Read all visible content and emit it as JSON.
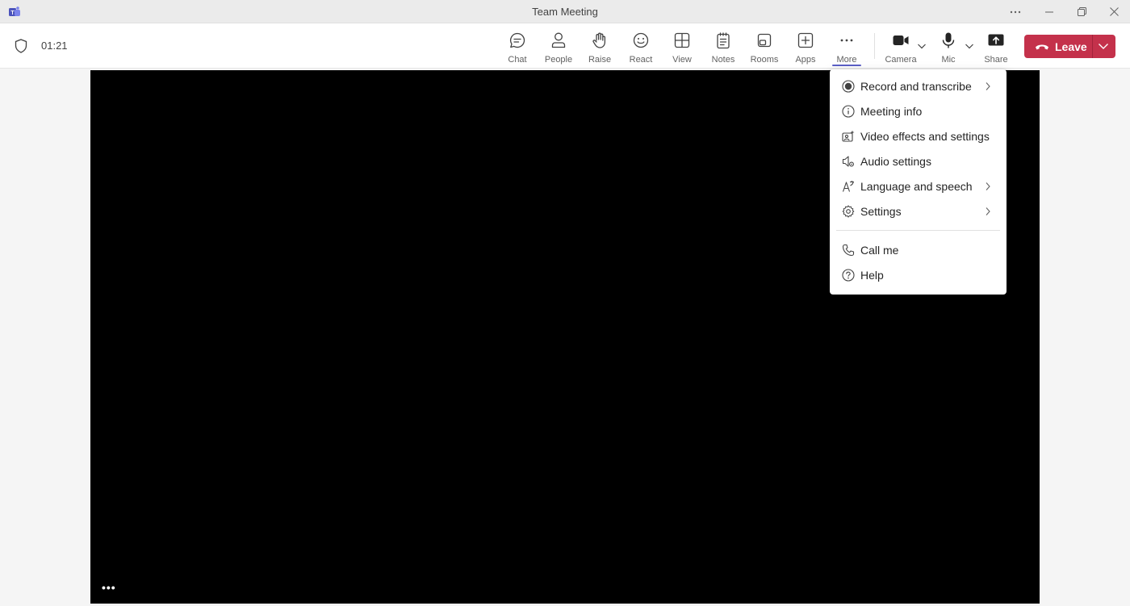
{
  "window": {
    "title": "Team Meeting"
  },
  "meeting": {
    "timer": "01:21"
  },
  "toolbar": {
    "chat": "Chat",
    "people": "People",
    "raise": "Raise",
    "react": "React",
    "view": "View",
    "notes": "Notes",
    "rooms": "Rooms",
    "apps": "Apps",
    "more": "More",
    "camera": "Camera",
    "mic": "Mic",
    "share": "Share",
    "leave": "Leave"
  },
  "more_menu": {
    "items": [
      {
        "label": "Record and transcribe",
        "icon": "record-icon",
        "submenu": true
      },
      {
        "label": "Meeting info",
        "icon": "info-icon",
        "submenu": false
      },
      {
        "label": "Video effects and settings",
        "icon": "video-effects-icon",
        "submenu": false
      },
      {
        "label": "Audio settings",
        "icon": "audio-settings-icon",
        "submenu": false
      },
      {
        "label": "Language and speech",
        "icon": "language-icon",
        "submenu": true
      },
      {
        "label": "Settings",
        "icon": "gear-icon",
        "submenu": true
      },
      {
        "label": "Call me",
        "icon": "phone-icon",
        "submenu": false
      },
      {
        "label": "Help",
        "icon": "help-icon",
        "submenu": false
      }
    ]
  },
  "colors": {
    "leave_button": "#c4314b",
    "active_underline": "#5b5fc7",
    "stage": "#000000"
  }
}
